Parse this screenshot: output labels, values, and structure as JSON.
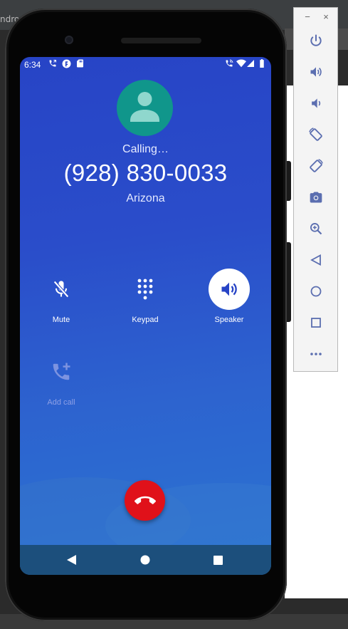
{
  "ide": {
    "title_fragment": "ndro"
  },
  "status_bar": {
    "time": "6:34",
    "left_icons": [
      "phone-call-icon",
      "app-notification-icon",
      "sd-card-icon"
    ],
    "right_icons": [
      "wifi-calling-icon",
      "wifi-icon",
      "signal-icon",
      "battery-icon"
    ]
  },
  "call": {
    "status": "Calling…",
    "number": "(928) 830-0033",
    "location": "Arizona"
  },
  "controls": {
    "mute": {
      "label": "Mute",
      "icon": "mic-off-icon"
    },
    "keypad": {
      "label": "Keypad",
      "icon": "dialpad-icon"
    },
    "speaker": {
      "label": "Speaker",
      "icon": "speaker-icon",
      "active": true
    },
    "add_call": {
      "label": "Add call",
      "icon": "add-call-icon",
      "enabled": false
    }
  },
  "end_call": {
    "icon": "end-call-icon",
    "color": "#e0111a"
  },
  "nav": [
    "back-icon",
    "home-icon",
    "recents-icon"
  ],
  "emulator_toolbar": {
    "window_controls": [
      "−",
      "×"
    ],
    "buttons": [
      "power-icon",
      "volume-up-icon",
      "volume-down-icon",
      "rotate-left-icon",
      "rotate-right-icon",
      "camera-icon",
      "zoom-icon",
      "back-icon",
      "home-icon",
      "overview-icon",
      "more-icon"
    ]
  },
  "colors": {
    "screen_blue": "#2a4dca",
    "avatar": "#10968b",
    "nav_bar": "#1c4f7c",
    "end_call": "#e0111a"
  }
}
